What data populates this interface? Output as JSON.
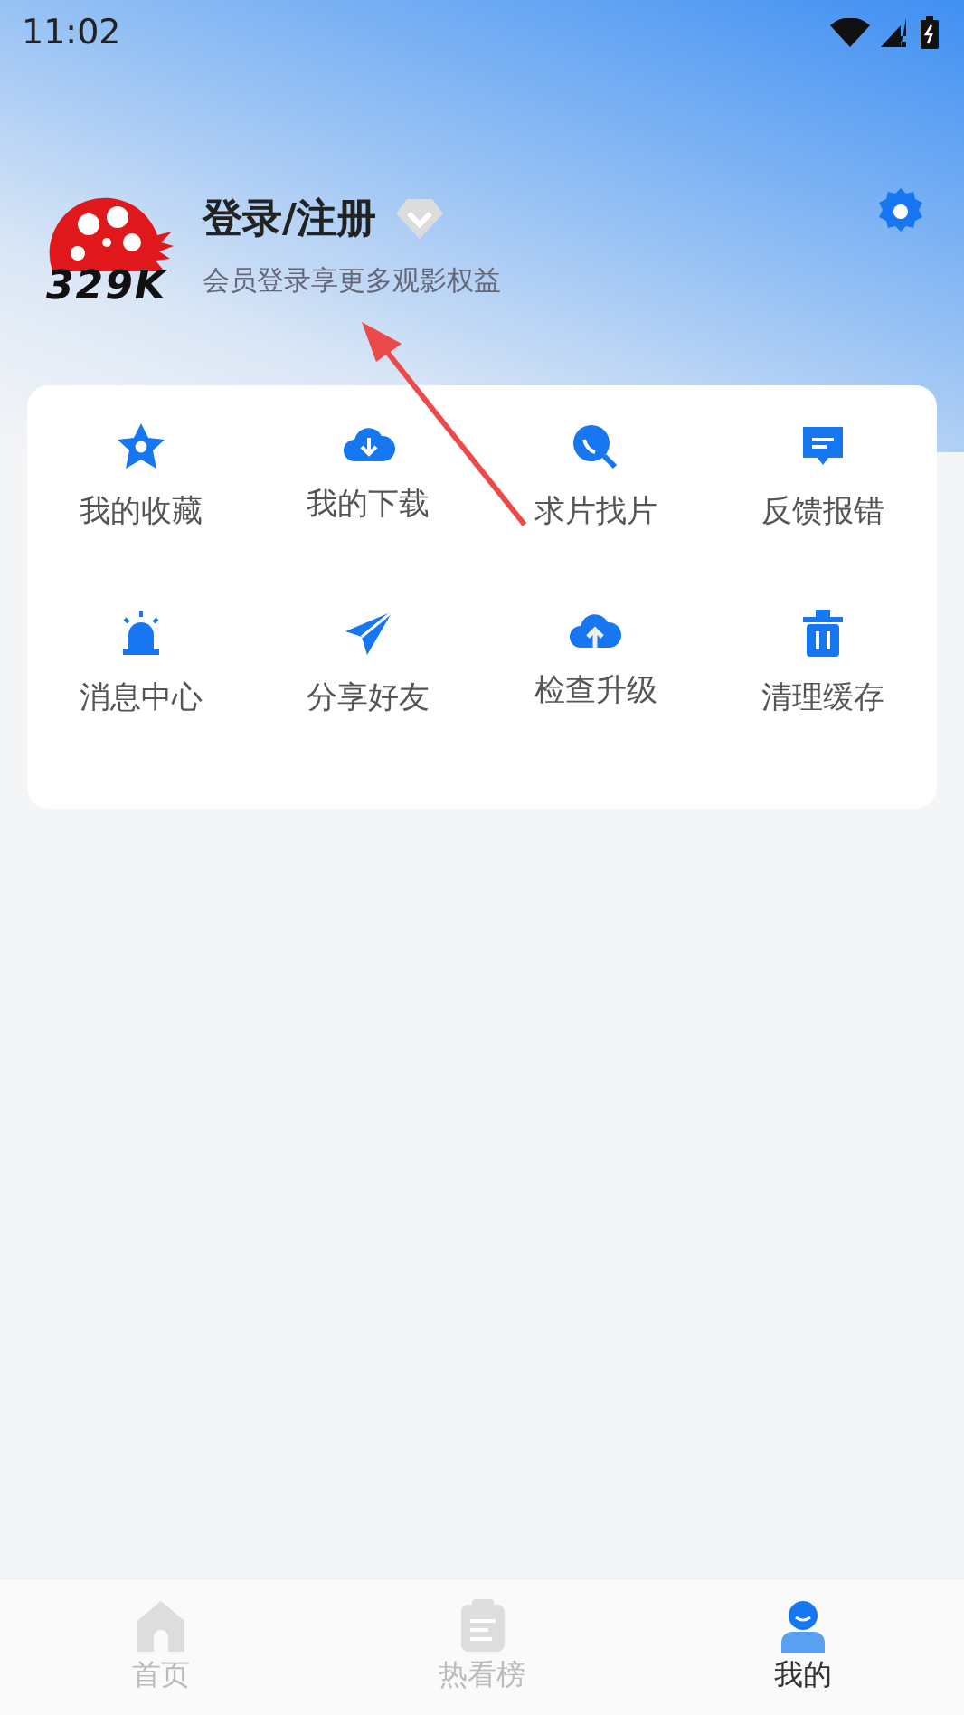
{
  "status_bar": {
    "time": "11:02"
  },
  "profile": {
    "logo_text": "329K",
    "title": "登录/注册",
    "subtitle": "会员登录享更多观影权益"
  },
  "menu": [
    {
      "kind": "star",
      "label": "我的收藏"
    },
    {
      "kind": "download",
      "label": "我的下载"
    },
    {
      "kind": "search",
      "label": "求片找片"
    },
    {
      "kind": "feedback",
      "label": "反馈报错"
    },
    {
      "kind": "alarm",
      "label": "消息中心"
    },
    {
      "kind": "share",
      "label": "分享好友"
    },
    {
      "kind": "upload",
      "label": "检查升级"
    },
    {
      "kind": "trash",
      "label": "清理缓存"
    }
  ],
  "bottom_nav": [
    {
      "kind": "home",
      "label": "首页",
      "selected": false
    },
    {
      "kind": "list",
      "label": "热看榜",
      "selected": false
    },
    {
      "kind": "user",
      "label": "我的",
      "selected": true
    }
  ]
}
